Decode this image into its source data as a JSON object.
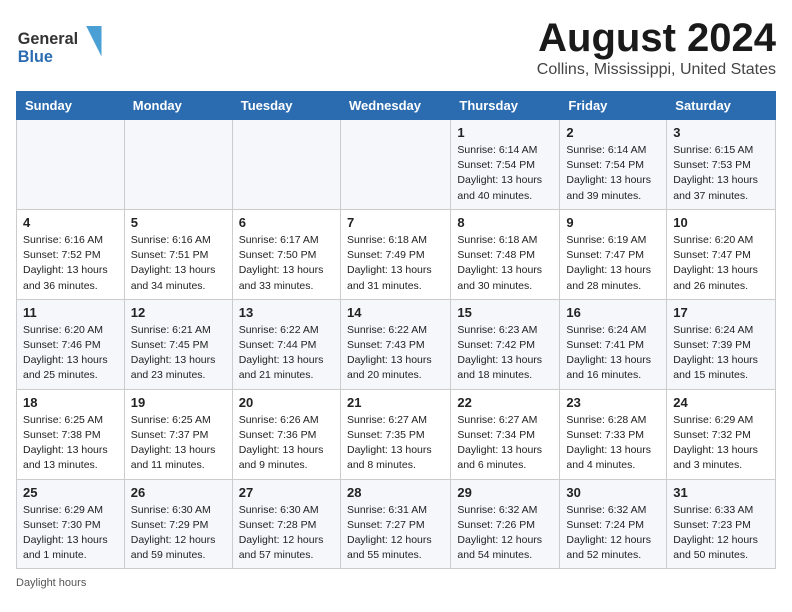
{
  "header": {
    "logo_general": "General",
    "logo_blue": "Blue",
    "month": "August 2024",
    "location": "Collins, Mississippi, United States"
  },
  "days_of_week": [
    "Sunday",
    "Monday",
    "Tuesday",
    "Wednesday",
    "Thursday",
    "Friday",
    "Saturday"
  ],
  "weeks": [
    [
      {
        "day": "",
        "info": ""
      },
      {
        "day": "",
        "info": ""
      },
      {
        "day": "",
        "info": ""
      },
      {
        "day": "",
        "info": ""
      },
      {
        "day": "1",
        "info": "Sunrise: 6:14 AM\nSunset: 7:54 PM\nDaylight: 13 hours and 40 minutes."
      },
      {
        "day": "2",
        "info": "Sunrise: 6:14 AM\nSunset: 7:54 PM\nDaylight: 13 hours and 39 minutes."
      },
      {
        "day": "3",
        "info": "Sunrise: 6:15 AM\nSunset: 7:53 PM\nDaylight: 13 hours and 37 minutes."
      }
    ],
    [
      {
        "day": "4",
        "info": "Sunrise: 6:16 AM\nSunset: 7:52 PM\nDaylight: 13 hours and 36 minutes."
      },
      {
        "day": "5",
        "info": "Sunrise: 6:16 AM\nSunset: 7:51 PM\nDaylight: 13 hours and 34 minutes."
      },
      {
        "day": "6",
        "info": "Sunrise: 6:17 AM\nSunset: 7:50 PM\nDaylight: 13 hours and 33 minutes."
      },
      {
        "day": "7",
        "info": "Sunrise: 6:18 AM\nSunset: 7:49 PM\nDaylight: 13 hours and 31 minutes."
      },
      {
        "day": "8",
        "info": "Sunrise: 6:18 AM\nSunset: 7:48 PM\nDaylight: 13 hours and 30 minutes."
      },
      {
        "day": "9",
        "info": "Sunrise: 6:19 AM\nSunset: 7:47 PM\nDaylight: 13 hours and 28 minutes."
      },
      {
        "day": "10",
        "info": "Sunrise: 6:20 AM\nSunset: 7:47 PM\nDaylight: 13 hours and 26 minutes."
      }
    ],
    [
      {
        "day": "11",
        "info": "Sunrise: 6:20 AM\nSunset: 7:46 PM\nDaylight: 13 hours and 25 minutes."
      },
      {
        "day": "12",
        "info": "Sunrise: 6:21 AM\nSunset: 7:45 PM\nDaylight: 13 hours and 23 minutes."
      },
      {
        "day": "13",
        "info": "Sunrise: 6:22 AM\nSunset: 7:44 PM\nDaylight: 13 hours and 21 minutes."
      },
      {
        "day": "14",
        "info": "Sunrise: 6:22 AM\nSunset: 7:43 PM\nDaylight: 13 hours and 20 minutes."
      },
      {
        "day": "15",
        "info": "Sunrise: 6:23 AM\nSunset: 7:42 PM\nDaylight: 13 hours and 18 minutes."
      },
      {
        "day": "16",
        "info": "Sunrise: 6:24 AM\nSunset: 7:41 PM\nDaylight: 13 hours and 16 minutes."
      },
      {
        "day": "17",
        "info": "Sunrise: 6:24 AM\nSunset: 7:39 PM\nDaylight: 13 hours and 15 minutes."
      }
    ],
    [
      {
        "day": "18",
        "info": "Sunrise: 6:25 AM\nSunset: 7:38 PM\nDaylight: 13 hours and 13 minutes."
      },
      {
        "day": "19",
        "info": "Sunrise: 6:25 AM\nSunset: 7:37 PM\nDaylight: 13 hours and 11 minutes."
      },
      {
        "day": "20",
        "info": "Sunrise: 6:26 AM\nSunset: 7:36 PM\nDaylight: 13 hours and 9 minutes."
      },
      {
        "day": "21",
        "info": "Sunrise: 6:27 AM\nSunset: 7:35 PM\nDaylight: 13 hours and 8 minutes."
      },
      {
        "day": "22",
        "info": "Sunrise: 6:27 AM\nSunset: 7:34 PM\nDaylight: 13 hours and 6 minutes."
      },
      {
        "day": "23",
        "info": "Sunrise: 6:28 AM\nSunset: 7:33 PM\nDaylight: 13 hours and 4 minutes."
      },
      {
        "day": "24",
        "info": "Sunrise: 6:29 AM\nSunset: 7:32 PM\nDaylight: 13 hours and 3 minutes."
      }
    ],
    [
      {
        "day": "25",
        "info": "Sunrise: 6:29 AM\nSunset: 7:30 PM\nDaylight: 13 hours and 1 minute."
      },
      {
        "day": "26",
        "info": "Sunrise: 6:30 AM\nSunset: 7:29 PM\nDaylight: 12 hours and 59 minutes."
      },
      {
        "day": "27",
        "info": "Sunrise: 6:30 AM\nSunset: 7:28 PM\nDaylight: 12 hours and 57 minutes."
      },
      {
        "day": "28",
        "info": "Sunrise: 6:31 AM\nSunset: 7:27 PM\nDaylight: 12 hours and 55 minutes."
      },
      {
        "day": "29",
        "info": "Sunrise: 6:32 AM\nSunset: 7:26 PM\nDaylight: 12 hours and 54 minutes."
      },
      {
        "day": "30",
        "info": "Sunrise: 6:32 AM\nSunset: 7:24 PM\nDaylight: 12 hours and 52 minutes."
      },
      {
        "day": "31",
        "info": "Sunrise: 6:33 AM\nSunset: 7:23 PM\nDaylight: 12 hours and 50 minutes."
      }
    ]
  ],
  "footer": {
    "daylight_label": "Daylight hours"
  }
}
